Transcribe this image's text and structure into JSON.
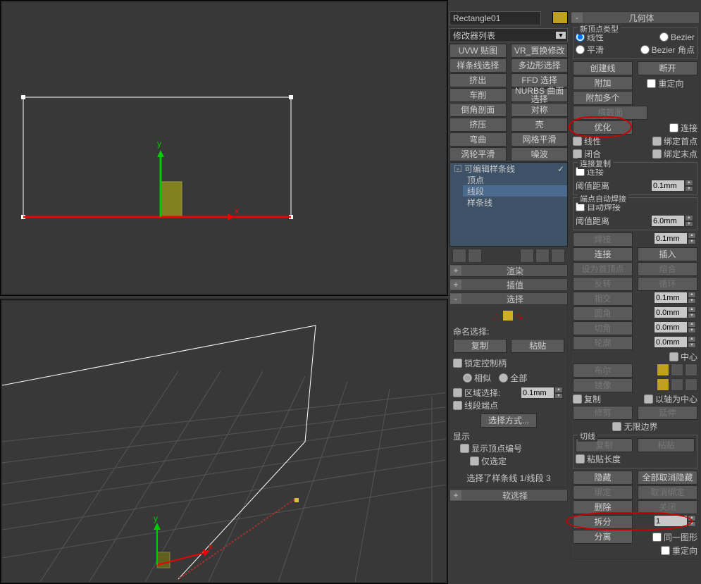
{
  "object_name": "Rectangle01",
  "modifier_dropdown": "修改器列表",
  "modifier_buttons": [
    [
      "UVW 贴图",
      "VR_置换修改"
    ],
    [
      "样条线选择",
      "多边形选择"
    ],
    [
      "挤出",
      "FFD 选择"
    ],
    [
      "车削",
      "NURBS 曲面选择"
    ],
    [
      "倒角剖面",
      "对称"
    ],
    [
      "挤压",
      "壳"
    ],
    [
      "弯曲",
      "网格平滑"
    ],
    [
      "涡轮平滑",
      "噪波"
    ]
  ],
  "stack": {
    "root": "可编辑样条线",
    "children": [
      "顶点",
      "线段",
      "样条线"
    ],
    "selected": "线段"
  },
  "rollouts": {
    "render": "渲染",
    "interpolation": "插值",
    "selection": "选择",
    "soft_selection": "软选择",
    "geometry": "几何体"
  },
  "selection_panel": {
    "named_sel": "命名选择:",
    "copy": "复制",
    "paste": "粘贴",
    "lock_handles": "锁定控制柄",
    "similar": "相似",
    "all": "全部",
    "area_select": "区域选择:",
    "area_val": "0.1mm",
    "segment_end": "线段端点",
    "select_by": "选择方式...",
    "display": "显示",
    "show_vertex_num": "显示顶点编号",
    "only_selected": "仅选定",
    "status": "选择了样条线 1/线段 3"
  },
  "geometry_panel": {
    "new_vertex_type": "新顶点类型",
    "linear": "线性",
    "bezier": "Bezier",
    "smooth": "平滑",
    "bezier_corner": "Bezier 角点",
    "create_line": "创建线",
    "break": "断开",
    "attach": "附加",
    "reorient": "重定向",
    "attach_multi": "附加多个",
    "cross_section": "横截面",
    "optimize": "优化",
    "connect": "连接",
    "linear2": "线性",
    "bind_first": "绑定首点",
    "close": "闭合",
    "bind_last": "绑定末点",
    "connect_copy_grp": "连接复制",
    "connect2": "连接",
    "threshold_dist": "阈值距离",
    "thresh_val1": "0.1mm",
    "end_auto_weld_grp": "端点自动焊接",
    "auto_weld": "自动焊接",
    "thresh_val2": "6.0mm",
    "weld": "焊接",
    "weld_val": "0.1mm",
    "connect3": "连接",
    "insert": "插入",
    "make_first": "设为首顶点",
    "fuse": "熔合",
    "reverse": "反转",
    "cycle": "循环",
    "crossinsert": "相交",
    "cross_val": "0.1mm",
    "fillet": "圆角",
    "fillet_val": "0.0mm",
    "chamfer": "切角",
    "chamfer_val": "0.0mm",
    "outline": "轮廓",
    "outline_val": "0.0mm",
    "center": "中心",
    "boolean": "布尔",
    "mirror": "镜像",
    "copy2": "复制",
    "about_pivot": "以轴为中心",
    "trim": "修剪",
    "extend": "延伸",
    "infinite": "无限边界",
    "tangent_grp": "切线",
    "copy3": "复制",
    "paste2": "粘贴",
    "paste_length": "粘贴长度",
    "hide": "隐藏",
    "unhide": "全部取消隐藏",
    "bind": "绑定",
    "unbind": "取消绑定",
    "delete": "删除",
    "close2": "关闭",
    "divide": "拆分",
    "divide_val": "1",
    "detach": "分离",
    "same_shape": "同一图形",
    "reorient2": "重定向"
  }
}
